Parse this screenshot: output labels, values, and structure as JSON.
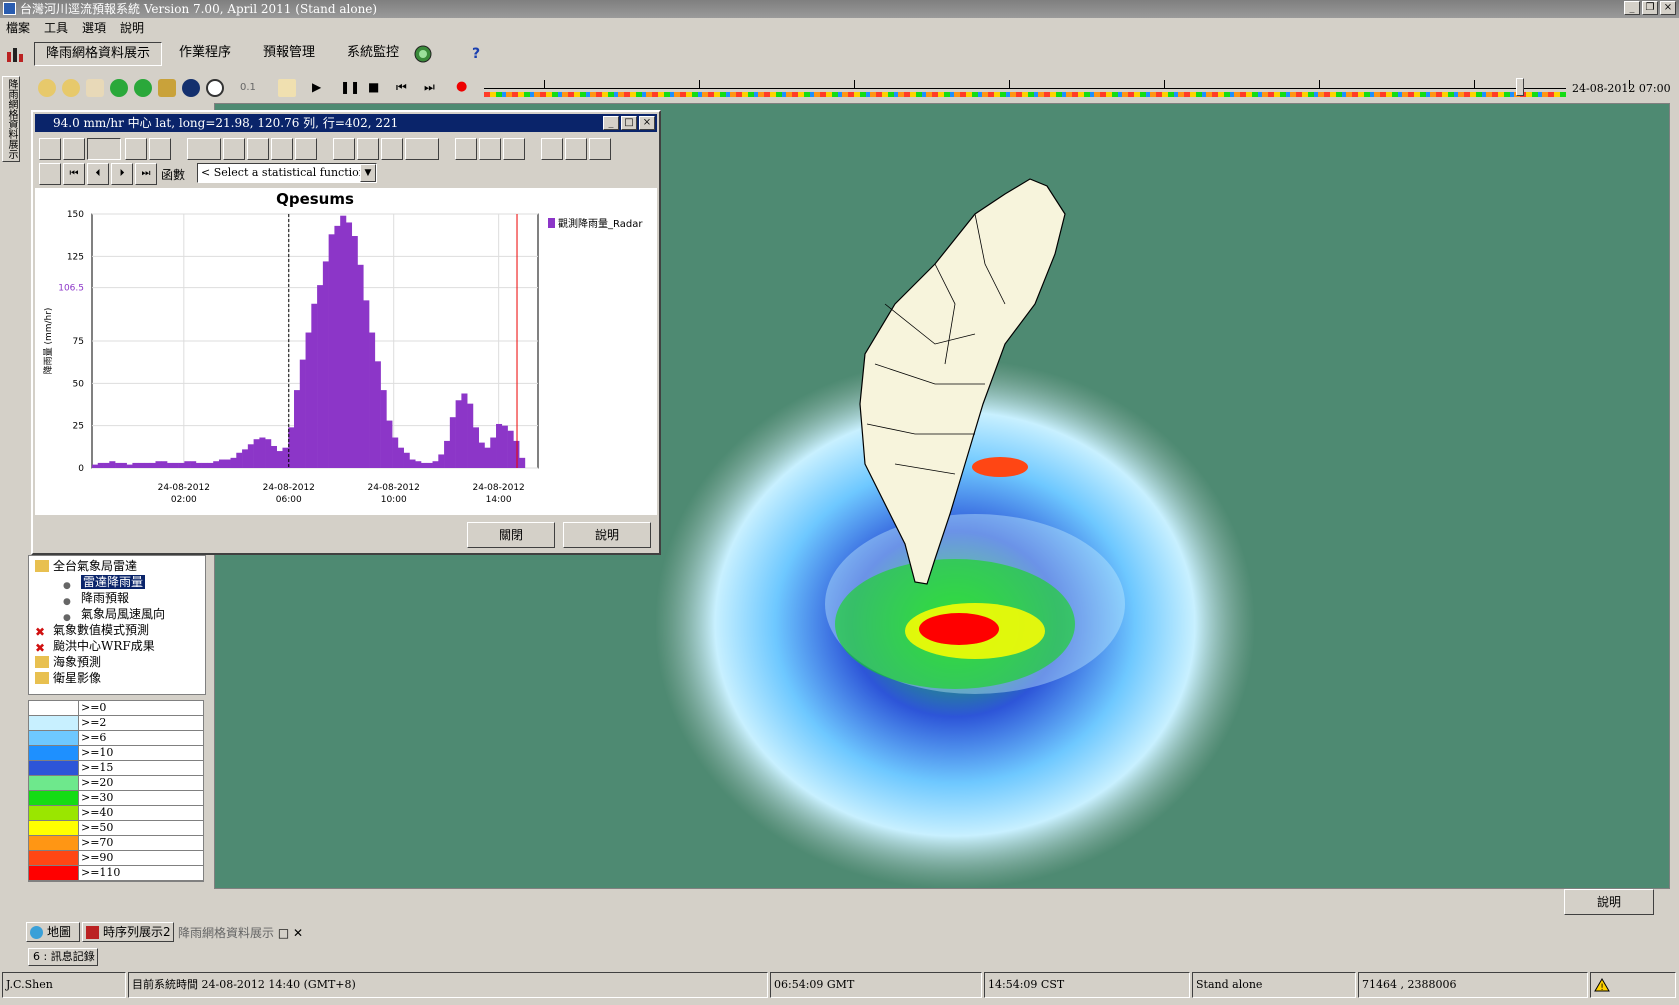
{
  "window": {
    "title": "台灣河川逕流預報系統 Version 7.00, April 2011   (Stand alone)"
  },
  "menu": [
    "檔案",
    "工具",
    "選項",
    "說明"
  ],
  "main_tabs": [
    "降雨網格資料展示",
    "作業程序",
    "預報管理",
    "系統監控"
  ],
  "toolbar": {
    "zoom_label": "0.1",
    "help_glyph": "?"
  },
  "timeline": {
    "time": "24-08-2012 07:00"
  },
  "side_strip": "降雨網格資料展示 5:",
  "chart_window": {
    "title": "94.0 mm/hr  中心 lat, long=21.98, 120.76  列, 行=402, 221",
    "function_label": "函數",
    "function_select": "< Select a statistical function >",
    "close_button": "關閉",
    "help_button": "說明"
  },
  "chart_data": {
    "type": "bar",
    "title": "Qpesums",
    "ylabel": "降雨量 (mm/hr)",
    "xlabel": "",
    "ylim": [
      0,
      150
    ],
    "yticks": [
      0,
      25,
      50,
      75,
      106.5,
      125,
      150
    ],
    "highlight_y": 106.5,
    "series_name": "觀測降雨量_Radar",
    "series_color": "#8c36c8",
    "x_ticks": [
      {
        "date": "24-08-2012",
        "time": "02:00",
        "hour": 2
      },
      {
        "date": "24-08-2012",
        "time": "06:00",
        "hour": 6
      },
      {
        "date": "24-08-2012",
        "time": "10:00",
        "hour": 10
      },
      {
        "date": "24-08-2012",
        "time": "14:00",
        "hour": 14
      }
    ],
    "xrange_hours": [
      -1.5,
      15.5
    ],
    "values": [
      2,
      3,
      3,
      4,
      3,
      3,
      2,
      3,
      3,
      3,
      3,
      4,
      4,
      3,
      3,
      3,
      4,
      4,
      3,
      3,
      3,
      4,
      5,
      5,
      6,
      9,
      11,
      14,
      17,
      18,
      17,
      13,
      10,
      12,
      24,
      46,
      64,
      80,
      97,
      108,
      122,
      138,
      143,
      149,
      145,
      137,
      120,
      99,
      80,
      63,
      46,
      28,
      18,
      12,
      9,
      5,
      4,
      3,
      3,
      4,
      8,
      16,
      30,
      40,
      44,
      38,
      24,
      15,
      12,
      18,
      26,
      25,
      22,
      16,
      6
    ],
    "value_hour_start": -1.5,
    "value_hour_step": 0.22,
    "dashed_marker_hour": 6.0,
    "red_marker_hour": 14.7
  },
  "tree": [
    {
      "label": "全台氣象局雷達",
      "level": 0,
      "kind": "folder"
    },
    {
      "label": "雷達降雨量",
      "level": 1,
      "kind": "leaf",
      "selected": true
    },
    {
      "label": "降雨預報",
      "level": 1,
      "kind": "leaf"
    },
    {
      "label": "氣象局風速風向",
      "level": 1,
      "kind": "leaf"
    },
    {
      "label": "氣象數值模式預測",
      "level": 0,
      "kind": "error"
    },
    {
      "label": "颱洪中心WRF成果",
      "level": 0,
      "kind": "error"
    },
    {
      "label": "海象預測",
      "level": 0,
      "kind": "folder"
    },
    {
      "label": "衛星影像",
      "level": 0,
      "kind": "folder"
    }
  ],
  "legend": [
    {
      "label": ">=0",
      "color": "#ffffff"
    },
    {
      "label": ">=2",
      "color": "#c8f0ff"
    },
    {
      "label": ">=6",
      "color": "#6ec8ff"
    },
    {
      "label": ">=10",
      "color": "#1e90ff"
    },
    {
      "label": ">=15",
      "color": "#2d55d8"
    },
    {
      "label": ">=20",
      "color": "#6ee88c"
    },
    {
      "label": ">=30",
      "color": "#14dc14"
    },
    {
      "label": ">=40",
      "color": "#9ae600"
    },
    {
      "label": ">=50",
      "color": "#ffff00"
    },
    {
      "label": ">=70",
      "color": "#ff9614"
    },
    {
      "label": ">=90",
      "color": "#ff4614"
    },
    {
      "label": ">=110",
      "color": "#ff0000"
    }
  ],
  "map_help_button": "說明",
  "doc_tabs": [
    "地圖",
    "時序列展示2",
    "降雨網格資料展示"
  ],
  "message_tab": "6 : 訊息記錄",
  "status": {
    "user": "J.C.Shen",
    "system_time": "目前系統時間 24-08-2012 14:40 (GMT+8)",
    "gmt": "06:54:09 GMT",
    "cst": "14:54:09 CST",
    "mode": "Stand alone",
    "coords": "71464 , 2388006"
  }
}
